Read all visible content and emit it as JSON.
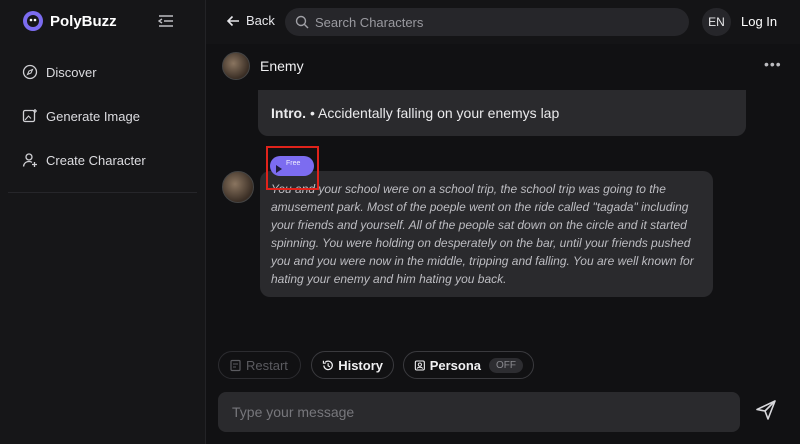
{
  "app": {
    "name": "PolyBuzz",
    "accent_color": "#7c6cf0"
  },
  "sidebar": {
    "items": [
      {
        "label": "Discover",
        "icon": "compass-icon"
      },
      {
        "label": "Generate Image",
        "icon": "image-plus-icon"
      },
      {
        "label": "Create Character",
        "icon": "user-plus-icon"
      }
    ]
  },
  "header": {
    "back_label": "Back",
    "search_placeholder": "Search Characters",
    "lang": "EN",
    "login_label": "Log In"
  },
  "chat": {
    "character_name": "Enemy",
    "more_label": "•••",
    "intro_label": "Intro.",
    "intro_text": "• Accidentally falling on your enemys lap",
    "free_label": "Free",
    "message_text": "You and your school were on a school trip, the school trip was going to the amusement park. Most of the poeple went on the ride called \"tagada\" including your friends and yourself. All of the people sat down on the circle and it started spinning. You were holding on desperately on the bar, until your friends pushed you and you were now in the middle, tripping and falling. You are well known for hating your enemy and him hating you back."
  },
  "actions": {
    "restart_label": "Restart",
    "history_label": "History",
    "persona_label": "Persona",
    "persona_state": "OFF"
  },
  "composer": {
    "placeholder": "Type your message"
  }
}
